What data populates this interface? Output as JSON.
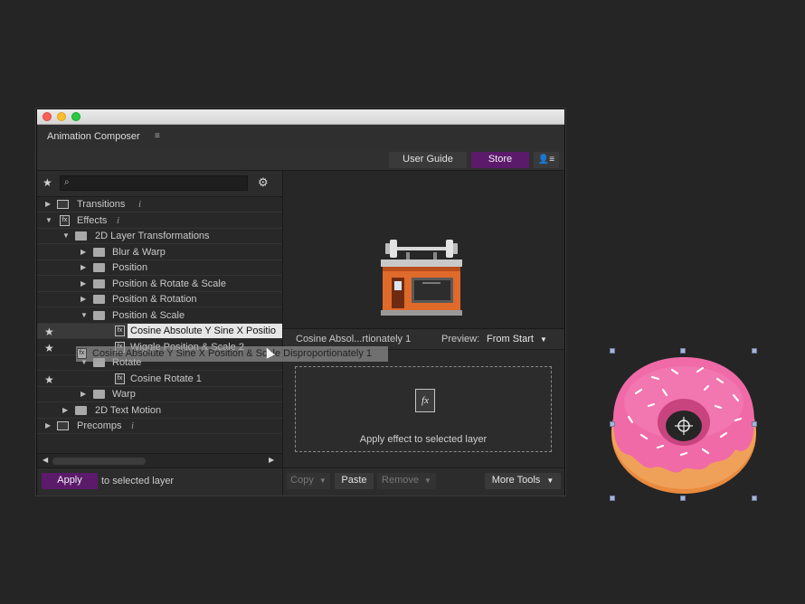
{
  "window": {
    "app_title": "Animation Composer",
    "menu_icon": "≡",
    "top_buttons": {
      "user_guide": "User Guide",
      "store": "Store",
      "user_icon": "👤≡"
    }
  },
  "left_panel": {
    "search": {
      "placeholder": "",
      "icon": "⌕"
    },
    "tree": [
      {
        "label": "Transitions",
        "info": "i"
      },
      {
        "label": "Effects",
        "info": "i"
      },
      {
        "label": "2D Layer Transformations"
      },
      {
        "label": "Blur & Warp"
      },
      {
        "label": "Position"
      },
      {
        "label": "Position & Rotate & Scale"
      },
      {
        "label": "Position & Rotation"
      },
      {
        "label": "Position & Scale"
      },
      {
        "label": "Cosine Absolute Y Sine X Positio"
      },
      {
        "label": "Wiggle Position & Scale 2"
      },
      {
        "label": "Rotate"
      },
      {
        "label": "Cosine Rotate 1"
      },
      {
        "label": "Warp"
      },
      {
        "label": "2D Text Motion"
      },
      {
        "label": "Precomps",
        "info": "i"
      }
    ],
    "drag_ghost_label": "Cosine Absolute Y Sine X Position & Scale Disproportionately 1",
    "bottom": {
      "apply": "Apply",
      "apply_suffix": "to selected layer"
    }
  },
  "right_panel": {
    "preset_name": "Cosine Absol...rtionately 1",
    "preview_label": "Preview:",
    "preview_value": "From Start",
    "drop_zone_text": "Apply effect to selected layer",
    "buttons": {
      "copy": "Copy",
      "paste": "Paste",
      "remove": "Remove",
      "more_tools": "More Tools"
    }
  },
  "colors": {
    "accent": "#5c1a6b",
    "donut_icing": "#f06aa8",
    "donut_dough": "#e98a3e"
  }
}
